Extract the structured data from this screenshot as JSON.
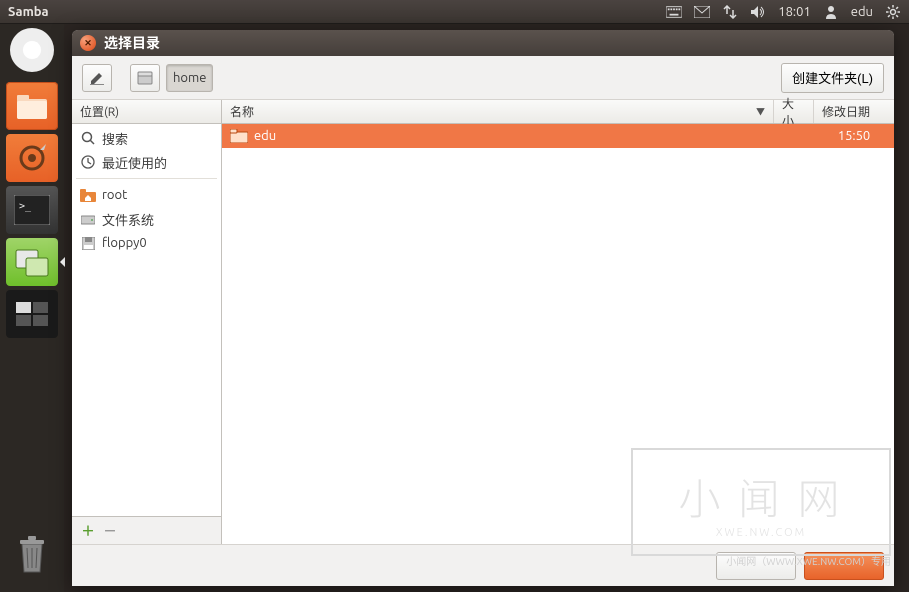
{
  "panel": {
    "app_name": "Samba",
    "time": "18:01",
    "user": "edu"
  },
  "dialog": {
    "title": "选择目录",
    "path_button_home": "home",
    "create_folder_btn": "创建文件夹(L)"
  },
  "sidebar": {
    "header": "位置(R)",
    "items": [
      {
        "icon": "search",
        "label": "搜索"
      },
      {
        "icon": "recent",
        "label": "最近使用的"
      },
      {
        "icon": "home",
        "label": "root"
      },
      {
        "icon": "drive",
        "label": "文件系统"
      },
      {
        "icon": "floppy",
        "label": "floppy0"
      }
    ]
  },
  "filelist": {
    "col_name": "名称",
    "col_size": "大小",
    "col_date": "修改日期",
    "rows": [
      {
        "name": "edu",
        "size": "",
        "date": "15:50",
        "selected": true
      }
    ]
  },
  "watermark": {
    "big": "小 闻 网",
    "sub": "XWE.NW.COM",
    "footer": "小闻网（WWW.XWE.NW.COM）专用"
  }
}
